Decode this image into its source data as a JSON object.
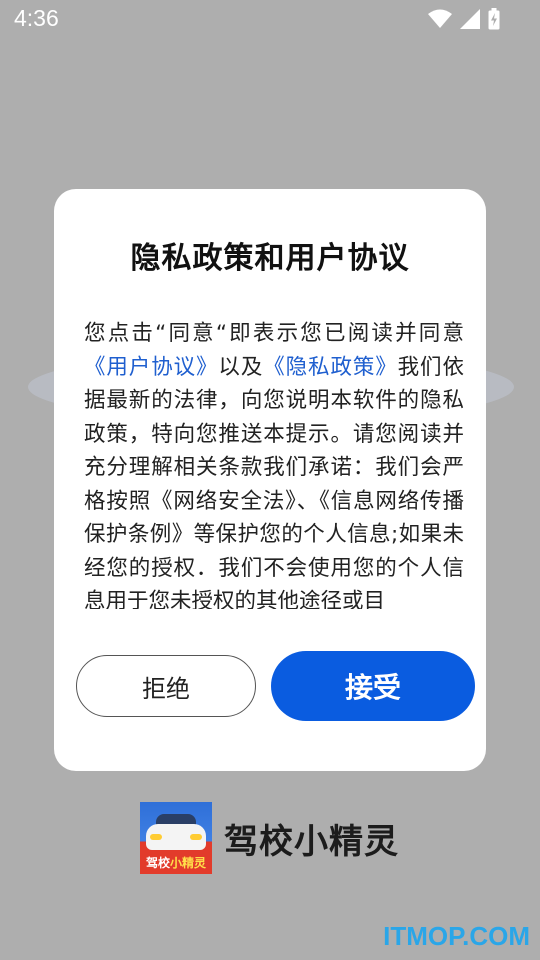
{
  "status_bar": {
    "time": "4:36",
    "icons": [
      "wifi-icon",
      "cellular-signal-icon",
      "battery-charging-icon"
    ]
  },
  "dialog": {
    "title": "隐私政策和用户协议",
    "body": {
      "text_1": "您点击“同意“即表示您已阅读并同意",
      "link_user_agreement": "《用户协议》",
      "text_2": "以及",
      "link_privacy_policy": "《隐私政策》",
      "text_3": "我们依据最新的法律，向您说明本软件的隐私政策，特向您推送本提示。请您阅读并充分理解相关条款我们承诺：我们会严格按照《网络安全法》、《信息网络传播保护条例》等保护您的个人信息;如果未经您的授权．我们不会使用您的个人信息用于您未授权的其他途径或目"
    },
    "refuse_label": "拒绝",
    "accept_label": "接受"
  },
  "brand": {
    "icon_caption_a": "驾校",
    "icon_caption_b": "小精灵",
    "app_name": "驾校小精灵"
  },
  "watermark": "ITMOP.COM",
  "colors": {
    "accent": "#0a5ce0",
    "link": "#1f5fcf",
    "overlay_background": "#aeaeae",
    "watermark": "#2aa6e8"
  }
}
